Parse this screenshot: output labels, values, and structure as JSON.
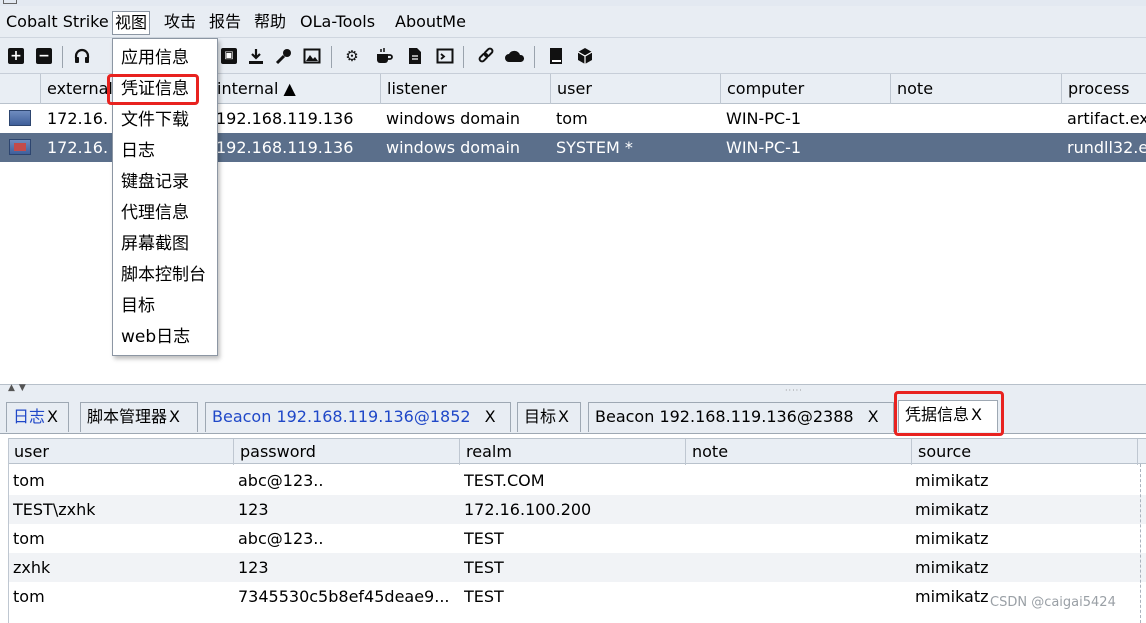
{
  "menubar": {
    "items": [
      "Cobalt Strike",
      "视图",
      "攻击",
      "报告",
      "帮助",
      "OLa-Tools",
      "AboutMe"
    ]
  },
  "toolbar": {
    "icons": [
      "plus-icon",
      "minus-icon",
      "headphones-icon",
      "image-icon",
      "download-icon",
      "key-icon",
      "picture-icon",
      "gear-icon",
      "coffee-icon",
      "document-icon",
      "terminal-icon",
      "link-icon",
      "cloud-icon",
      "book-icon",
      "cube-icon"
    ]
  },
  "sessions": {
    "columns": [
      "external",
      "internal ▲",
      "listener",
      "user",
      "computer",
      "note",
      "process"
    ],
    "rows": [
      {
        "external": "172.16.1",
        "internal": "192.168.119.136",
        "listener": "windows domain",
        "user": "tom",
        "computer": "WIN-PC-1",
        "note": "",
        "process": "artifact.ex",
        "selected": false
      },
      {
        "external": "172.16.1",
        "internal": "192.168.119.136",
        "listener": "windows domain",
        "user": "SYSTEM *",
        "computer": "WIN-PC-1",
        "note": "",
        "process": "rundll32.e",
        "selected": true
      }
    ]
  },
  "dropdown": {
    "items": [
      "应用信息",
      "凭证信息",
      "文件下载",
      "日志",
      "键盘记录",
      "代理信息",
      "屏幕截图",
      "脚本控制台",
      "目标",
      "web日志"
    ]
  },
  "tabs": [
    {
      "label": "日志",
      "close": "X",
      "blue": true
    },
    {
      "label": "脚本管理器",
      "close": "X",
      "blue": false
    },
    {
      "label": "Beacon 192.168.119.136@1852",
      "close": "X",
      "blue": true
    },
    {
      "label": "目标",
      "close": "X",
      "blue": false
    },
    {
      "label": "Beacon 192.168.119.136@2388",
      "close": "X",
      "blue": false
    },
    {
      "label": "凭据信息",
      "close": "X",
      "blue": false,
      "active": true
    }
  ],
  "credentials": {
    "columns": [
      "user",
      "password",
      "realm",
      "note",
      "source"
    ],
    "rows": [
      {
        "user": "tom",
        "password": "abc@123..",
        "realm": "TEST.COM",
        "note": "",
        "source": "mimikatz"
      },
      {
        "user": "TEST\\zxhk",
        "password": "123",
        "realm": "172.16.100.200",
        "note": "",
        "source": "mimikatz"
      },
      {
        "user": "tom",
        "password": "abc@123..",
        "realm": "TEST",
        "note": "",
        "source": "mimikatz"
      },
      {
        "user": "zxhk",
        "password": "123",
        "realm": "TEST",
        "note": "",
        "source": "mimikatz"
      },
      {
        "user": "tom",
        "password": "7345530c5b8ef45deae9...",
        "realm": "TEST",
        "note": "",
        "source": "mimikatz"
      }
    ]
  },
  "highlight_color": "#e8221f",
  "selection_color": "#5b6f8b",
  "watermark": "CSDN @caigai5424"
}
